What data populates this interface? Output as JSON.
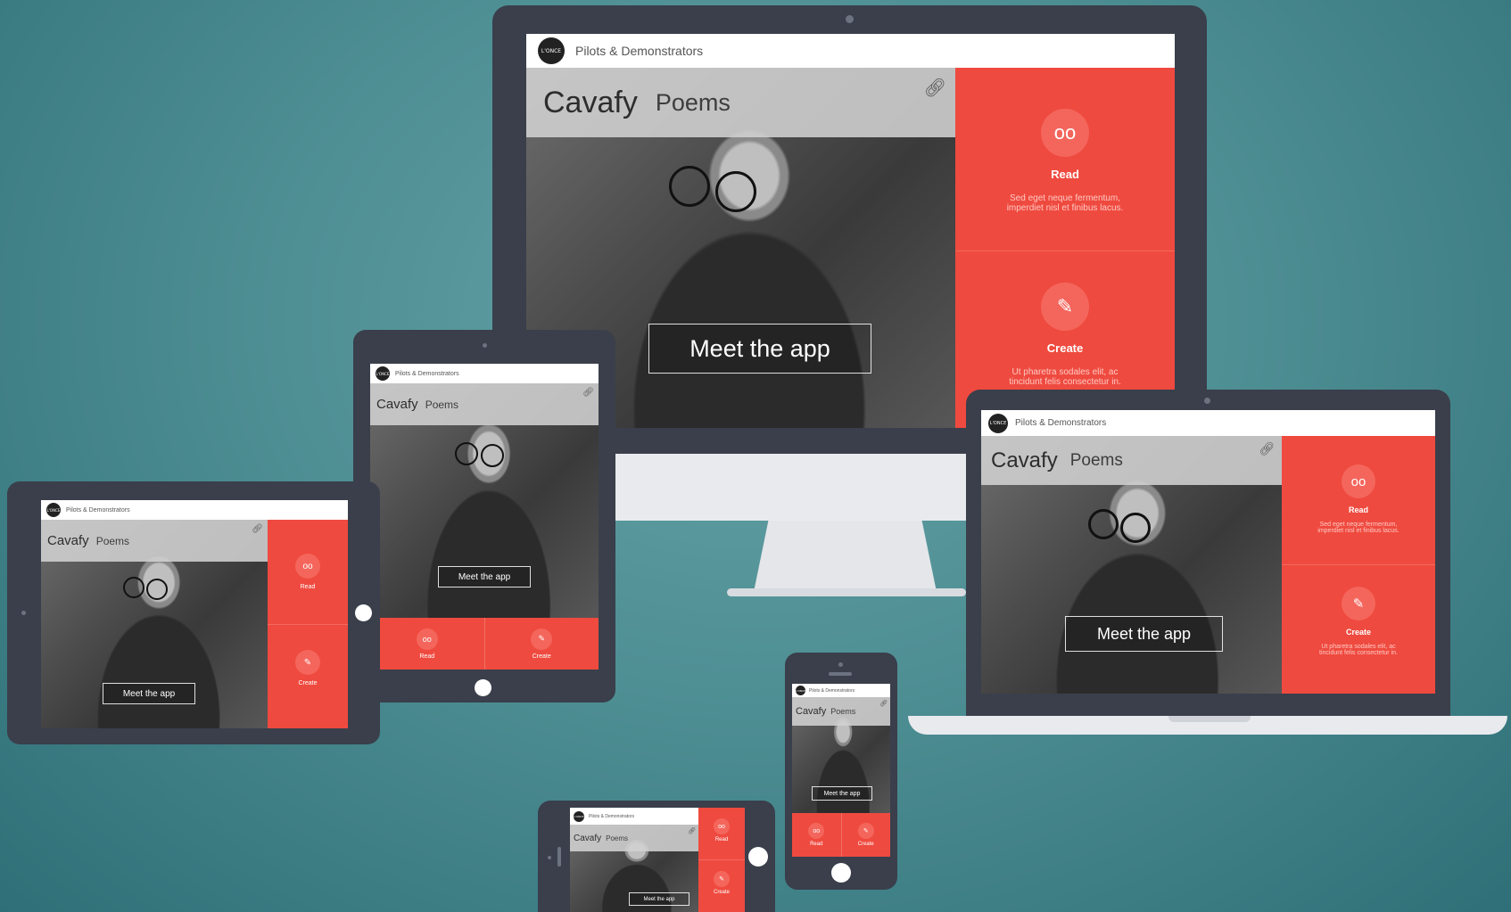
{
  "header": {
    "title": "Pilots & Demonstrators",
    "logo_text": "L'ONCE"
  },
  "app": {
    "title": "Cavafy",
    "subtitle": "Poems",
    "cta_label": "Meet the app",
    "read_label": "Read",
    "read_desc": "Sed eget neque fermentum, imperdiet nisl et finibus lacus.",
    "create_label": "Create",
    "create_desc": "Ut pharetra sodales elit, ac tincidunt felis consectetur in."
  },
  "icons": {
    "read": "glasses-icon",
    "create": "pencil-icon",
    "link": "link-icon"
  },
  "colors": {
    "accent": "#ef4a3f",
    "frame": "#3a3f4b",
    "background": "#4e8f94"
  }
}
